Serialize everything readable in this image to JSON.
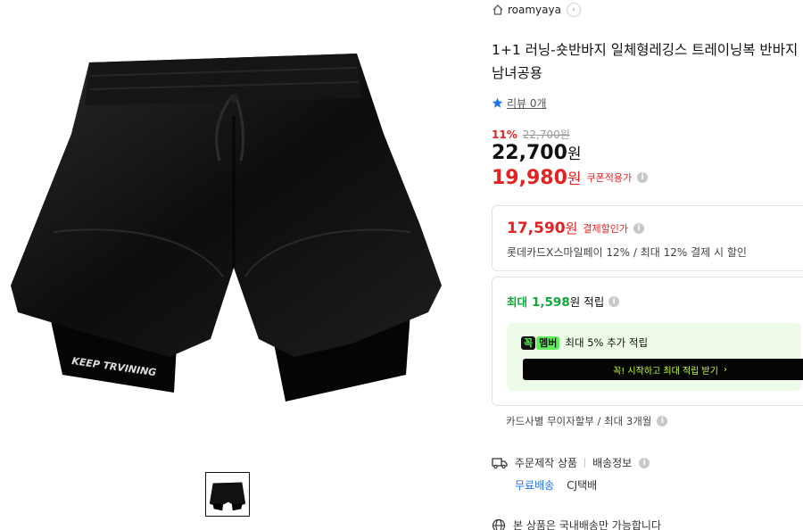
{
  "store": {
    "name": "roamyaya"
  },
  "product": {
    "title": "1+1 러닝-숏반바지 일체형레깅스 트레이닝복 반바지\n남녀공용",
    "image_text": "KEEP TRVINING"
  },
  "review": {
    "label": "리뷰 0개"
  },
  "price": {
    "discount_pct": "11%",
    "original": "22,700원",
    "sale_amount": "22,700",
    "won": "원",
    "coupon_amount": "19,980",
    "coupon_note": "쿠폰적용가"
  },
  "payment_discount": {
    "amount": "17,590",
    "won": "원",
    "note": "결제할인가",
    "detail": "롯데카드X스마일페이 12% / 최대 12% 결제 시 할인"
  },
  "points": {
    "prefix": "최대",
    "amount": "1,598",
    "suffix": "원 적립",
    "member_badge": "멤버",
    "member_text": "최대 5% 추가 적립",
    "cta_label": "꼭! 시작하고 최대 적립 받기",
    "cta_arrow": "›"
  },
  "installment": {
    "text": "카드사별 무이자할부 / 최대 3개월"
  },
  "shipping": {
    "made_to_order": "주문제작 상품",
    "info": "배송정보",
    "free": "무료배송",
    "courier": "CJ택배",
    "domestic": "본 상품은 국내배송만 가능합니다"
  },
  "colors": {
    "accent_red": "#e32222",
    "accent_green": "#0fa837",
    "link_blue": "#1a73e8"
  },
  "icons": [
    "home-icon",
    "chevron-right-icon",
    "star-icon",
    "info-icon",
    "truck-icon",
    "globe-icon"
  ]
}
